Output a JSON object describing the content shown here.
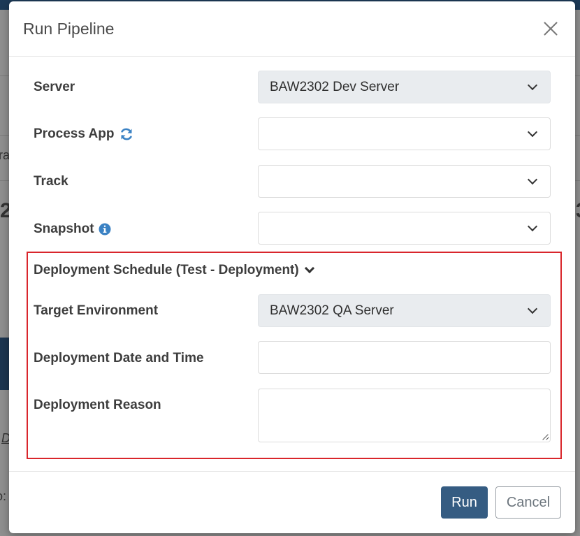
{
  "modal": {
    "title": "Run Pipeline"
  },
  "fields": {
    "server": {
      "label": "Server",
      "value": "BAW2302 Dev Server"
    },
    "process_app": {
      "label": "Process App",
      "value": ""
    },
    "track": {
      "label": "Track",
      "value": ""
    },
    "snapshot": {
      "label": "Snapshot",
      "value": ""
    }
  },
  "deployment": {
    "section_title": "Deployment Schedule (Test - Deployment)",
    "target_environment": {
      "label": "Target Environment",
      "value": "BAW2302 QA Server"
    },
    "date_time": {
      "label": "Deployment Date and Time",
      "value": ""
    },
    "reason": {
      "label": "Deployment Reason",
      "value": ""
    }
  },
  "footer": {
    "run_label": "Run",
    "cancel_label": "Cancel"
  },
  "colors": {
    "primary_button": "#355c82",
    "highlight_border": "#d9262c",
    "icon_blue": "#3b82c4"
  },
  "icons": {
    "process_app": "refresh-icon",
    "snapshot": "info-icon",
    "close": "close-icon"
  },
  "background": {
    "fragment_left_small": "ra",
    "fragment_left_big": "2",
    "fragment_right_big": "3",
    "fragment_left_d": "D",
    "fragment_left_p": "o:"
  }
}
